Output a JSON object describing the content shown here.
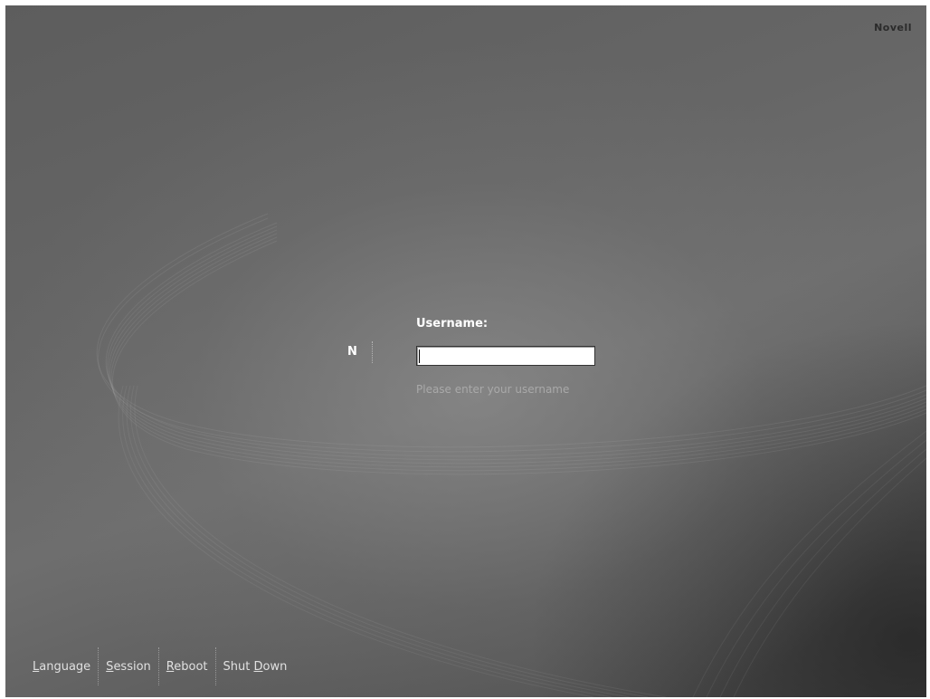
{
  "branding": {
    "company": "Novell",
    "logo_letter": "N"
  },
  "login": {
    "label": "Username:",
    "value": "",
    "hint": "Please enter your username"
  },
  "actions": [
    {
      "mnemonic": "L",
      "rest": "anguage"
    },
    {
      "mnemonic": "S",
      "rest": "ession"
    },
    {
      "mnemonic": "R",
      "rest": "eboot"
    },
    {
      "pre": "Shut ",
      "mnemonic": "D",
      "rest": "own"
    }
  ],
  "colors": {
    "text": "#ffffff",
    "hint": "#a9a9a9",
    "background": "#666666"
  }
}
